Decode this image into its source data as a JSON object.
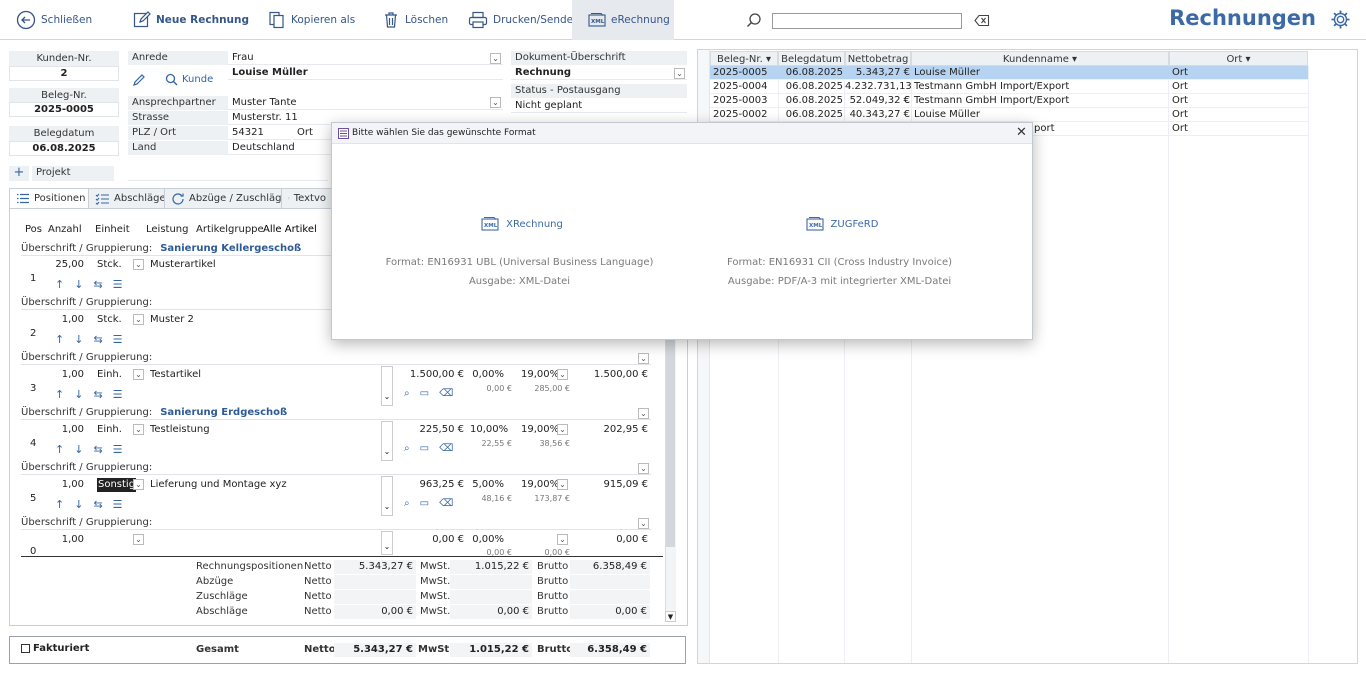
{
  "toolbar": {
    "close_label": "Schließen",
    "new_invoice_label": "Neue Rechnung",
    "copy_as_label": "Kopieren als",
    "delete_label": "Löschen",
    "print_send_label": "Drucken/Senden",
    "einvoice_label": "eRechnung",
    "search_value": "",
    "app_title": "Rechnungen"
  },
  "header": {
    "customer_no_label": "Kunden-Nr.",
    "customer_no": "2",
    "doc_no_label": "Beleg-Nr.",
    "doc_no": "2025-0005",
    "doc_date_label": "Belegdatum",
    "doc_date": "06.08.2025",
    "salutation_label": "Anrede",
    "salutation": "Frau",
    "name": "Louise Müller",
    "customer_button": "Kunde",
    "contact_label": "Ansprechpartner",
    "contact": "Muster Tante",
    "street_label": "Strasse",
    "street": "Musterstr. 11",
    "zip_city_label": "PLZ / Ort",
    "zip": "54321",
    "city": "Ort",
    "country_label": "Land",
    "country": "Deutschland",
    "doc_heading_label": "Dokument-Überschrift",
    "doc_heading": "Rechnung",
    "status_label": "Status - Postausgang",
    "status": "Nicht geplant",
    "project_label": "Projekt"
  },
  "tabs": [
    "Positionen",
    "Abschläge",
    "Abzüge / Zuschläge",
    "Textvo"
  ],
  "columns": {
    "pos": "Pos",
    "qty": "Anzahl",
    "unit": "Einheit",
    "service": "Leistung",
    "group": "Artikelgruppe",
    "group_value": "Alle Artikel"
  },
  "group_label": "Überschrift / Gruppierung:",
  "positions": [
    {
      "pos": "1",
      "group_title": "Sanierung Kellergeschoß",
      "qty": "25,00",
      "unit": "Stck.",
      "text": "Musterartikel"
    },
    {
      "pos": "2",
      "group_title": "",
      "qty": "1,00",
      "unit": "Stck.",
      "text": "Muster 2"
    },
    {
      "pos": "3",
      "group_title": "",
      "qty": "1,00",
      "unit": "Einh.",
      "text": "Testartikel",
      "price": "1.500,00 €",
      "disc": "0,00%",
      "disc_abs": "0,00 €",
      "vat": "19,00%",
      "vat_abs": "285,00 €",
      "total": "1.500,00 €"
    },
    {
      "pos": "4",
      "group_title": "Sanierung Erdgeschoß",
      "qty": "1,00",
      "unit": "Einh.",
      "text": "Testleistung",
      "price": "225,50 €",
      "disc": "10,00%",
      "disc_abs": "22,55 €",
      "vat": "19,00%",
      "vat_abs": "38,56 €",
      "total": "202,95 €"
    },
    {
      "pos": "5",
      "group_title": "",
      "qty": "1,00",
      "unit": "Sonstig",
      "text": "Lieferung und Montage xyz",
      "price": "963,25 €",
      "disc": "5,00%",
      "disc_abs": "48,16 €",
      "vat": "19,00%",
      "vat_abs": "173,87 €",
      "total": "915,09 €"
    },
    {
      "pos": "0",
      "group_title": "",
      "qty": "1,00",
      "unit": "",
      "text": "",
      "price": "0,00 €",
      "disc": "0,00%",
      "disc_abs": "0,00 €",
      "vat": "",
      "vat_abs": "0,00 €",
      "total": "0,00 €"
    }
  ],
  "totals": {
    "rows": [
      {
        "label": "Rechnungspositionen",
        "netto_label": "Netto",
        "netto": "5.343,27 €",
        "mwst_label": "MwSt.",
        "mwst": "1.015,22 €",
        "brutto_label": "Brutto",
        "brutto": "6.358,49 €"
      },
      {
        "label": "Abzüge",
        "netto_label": "Netto",
        "netto": "",
        "mwst_label": "MwSt.",
        "mwst": "",
        "brutto_label": "Brutto",
        "brutto": ""
      },
      {
        "label": "Zuschläge",
        "netto_label": "Netto",
        "netto": "",
        "mwst_label": "MwSt.",
        "mwst": "",
        "brutto_label": "Brutto",
        "brutto": ""
      },
      {
        "label": "Abschläge",
        "netto_label": "Netto",
        "netto": "0,00 €",
        "mwst_label": "MwSt.",
        "mwst": "0,00 €",
        "brutto_label": "Brutto",
        "brutto": "0,00 €"
      }
    ],
    "invoiced_label": "Fakturiert",
    "grand_label": "Gesamt",
    "grand_netto_label": "Netto",
    "grand_netto": "5.343,27 €",
    "grand_mwst_label": "MwSt.",
    "grand_mwst": "1.015,22 €",
    "grand_brutto_label": "Brutto",
    "grand_brutto": "6.358,49 €"
  },
  "list": {
    "headers": [
      "Beleg-Nr.",
      "Belegdatum",
      "Nettobetrag",
      "Kundenname",
      "Ort"
    ],
    "rows": [
      {
        "no": "2025-0005",
        "date": "06.08.2025",
        "net": "5.343,27 €",
        "name": "Louise Müller",
        "city": "Ort"
      },
      {
        "no": "2025-0004",
        "date": "06.08.2025",
        "net": "4.232.731,13 €",
        "name": "Testmann GmbH Import/Export",
        "city": "Ort"
      },
      {
        "no": "2025-0003",
        "date": "06.08.2025",
        "net": "52.049,32 €",
        "name": "Testmann GmbH Import/Export",
        "city": "Ort"
      },
      {
        "no": "2025-0002",
        "date": "06.08.2025",
        "net": "40.343,27 €",
        "name": "Louise Müller",
        "city": "Ort"
      },
      {
        "no": "",
        "date": "",
        "net": "",
        "name": "port",
        "city": "Ort"
      }
    ]
  },
  "modal": {
    "title": "Bitte wählen Sie das gewünschte Format",
    "option1_label": "XRechnung",
    "option1_format": "Format: EN16931 UBL (Universal Business Language)",
    "option1_output": "Ausgabe: XML-Datei",
    "option2_label": "ZUGFeRD",
    "option2_format": "Format: EN16931 CII (Cross Industry Invoice)",
    "option2_output": "Ausgabe: PDF/A-3 mit integrierter XML-Datei",
    "xml_badge": "XML"
  },
  "colors": {
    "accent": "#3c6aa6",
    "selected_row": "#b6d3f2",
    "label_bg": "#eef1f4"
  }
}
